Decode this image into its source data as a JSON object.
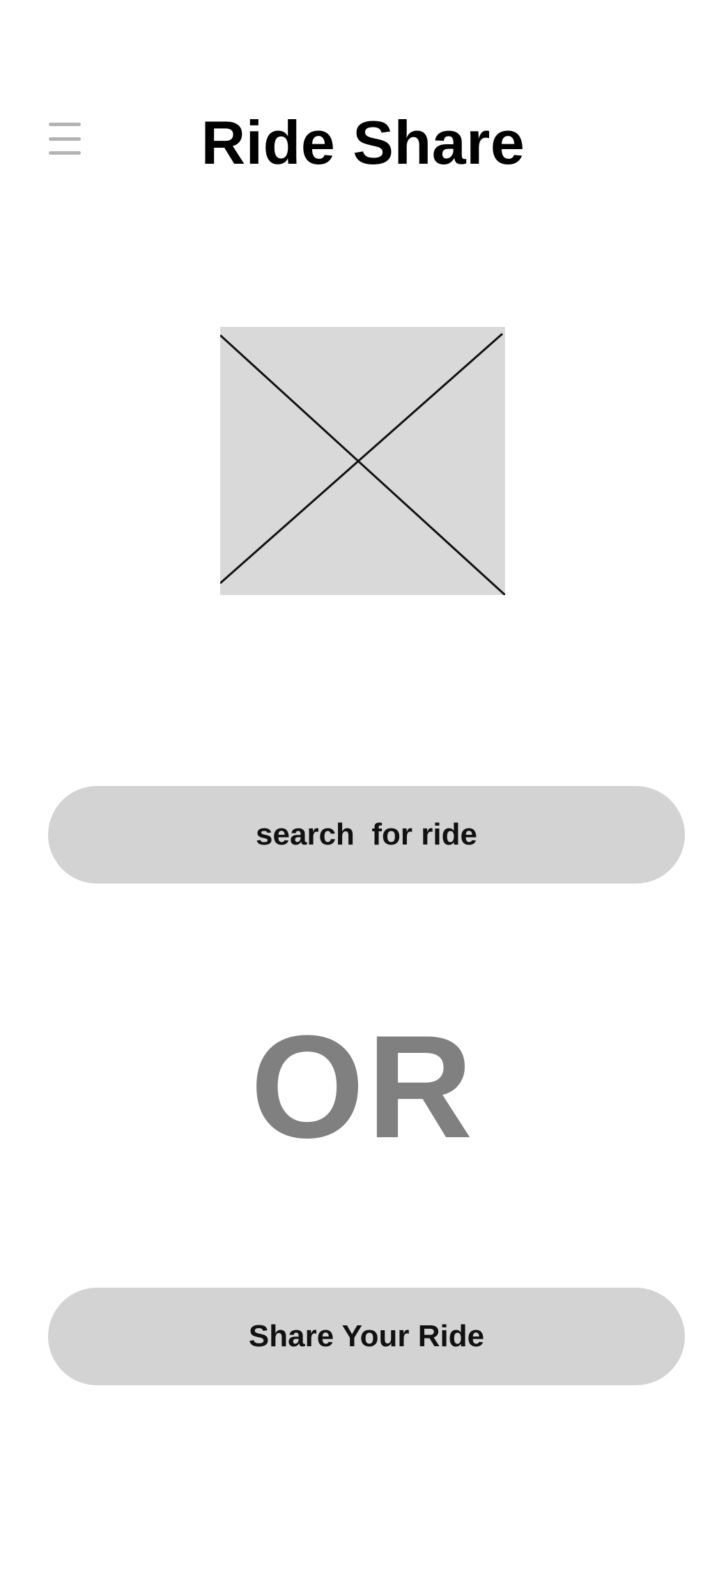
{
  "header": {
    "title": "Ride Share",
    "menu_icon": "hamburger-menu-icon"
  },
  "hero": {
    "placeholder_icon": "image-placeholder-icon",
    "placeholder_color": "#d9d9d9"
  },
  "actions": {
    "search_label": "search  for ride",
    "divider_label": "OR",
    "share_label": "Share Your Ride",
    "button_color": "#d3d3d3",
    "divider_color": "#808080"
  }
}
